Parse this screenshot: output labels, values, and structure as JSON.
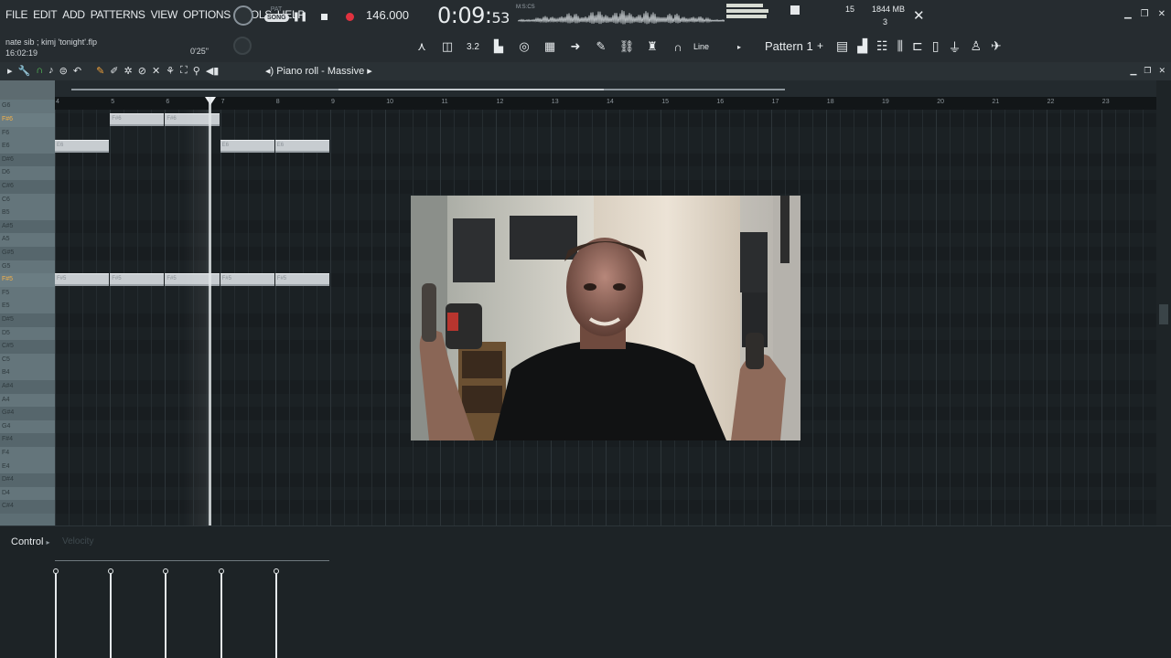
{
  "menu": [
    "FILE",
    "EDIT",
    "ADD",
    "PATTERNS",
    "VIEW",
    "OPTIONS",
    "TOOLS",
    "HELP"
  ],
  "project": {
    "name": "nate sib ; kimj 'tonight'.flp",
    "clock": "16:02:19"
  },
  "transport": {
    "pat_label": "PAT",
    "song_label": "SONG",
    "tempo": "146.000",
    "time": "0:09:",
    "time_small": "53",
    "time_units": "M:S:CS"
  },
  "status": {
    "polyphony": "15",
    "memory": "1844 MB",
    "cpu_count": "3",
    "latency": "0'25\""
  },
  "toolbar": {
    "snap": "Line",
    "pattern": "Pattern 1",
    "pattern_add": "+"
  },
  "piano_roll": {
    "title": "Piano roll - Massive",
    "ruler": [
      "4",
      "5",
      "6",
      "7",
      "8",
      "9",
      "10",
      "11",
      "12",
      "13",
      "14",
      "15",
      "16",
      "17",
      "18",
      "19",
      "20",
      "21",
      "22",
      "23"
    ],
    "keys": [
      "G6",
      "F#6",
      "F6",
      "E6",
      "D#6",
      "D6",
      "C#6",
      "C6",
      "B5",
      "A#5",
      "A5",
      "G#5",
      "G5",
      "F#5",
      "F5",
      "E5",
      "D#5",
      "D5",
      "C#5",
      "C5",
      "B4",
      "A#4",
      "A4",
      "G#4",
      "G4",
      "F#4",
      "F4",
      "E4",
      "D#4",
      "D4",
      "C#4"
    ],
    "highlight_keys": [
      "F#6",
      "F#5"
    ],
    "notes": [
      {
        "label": "F#6",
        "key": "F#6",
        "start": 5,
        "length": 1
      },
      {
        "label": "F#6",
        "key": "F#6",
        "start": 6,
        "length": 1
      },
      {
        "label": "E6",
        "key": "E6",
        "start": 4,
        "length": 1
      },
      {
        "label": "E6",
        "key": "E6",
        "start": 7,
        "length": 1
      },
      {
        "label": "E6",
        "key": "E6",
        "start": 8,
        "length": 1
      },
      {
        "label": "F#5",
        "key": "F#5",
        "start": 4,
        "length": 1
      },
      {
        "label": "F#5",
        "key": "F#5",
        "start": 5,
        "length": 1
      },
      {
        "label": "F#5",
        "key": "F#5",
        "start": 6,
        "length": 1
      },
      {
        "label": "F#5",
        "key": "F#5",
        "start": 7,
        "length": 1
      },
      {
        "label": "F#5",
        "key": "F#5",
        "start": 8,
        "length": 1
      }
    ],
    "playhead_bar": 6.77
  },
  "control": {
    "label": "Control",
    "sub": "Velocity",
    "velocities": [
      0.9,
      0.9,
      0.9,
      0.9,
      0.9
    ]
  }
}
